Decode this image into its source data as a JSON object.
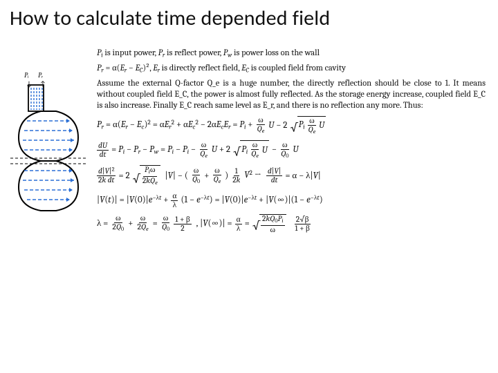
{
  "slide": {
    "title": "How to calculate time depended field"
  },
  "labels": {
    "Pi": "Pᵢ",
    "Pr": "Pᵣ"
  },
  "intro": {
    "line1_a": "P_i is input power, P_r is reflect power, P_w is power loss on the wall",
    "line2_a": "P_r = α(E_r − E_C)², E_r is directly reflect field, E_C is coupled field from cavity",
    "line3": "Assume the external Q-factor Q_e is a huge number, the directly reflection should be close to 1. It means without coupled field E_C, the power is almost fully reflected. As the storage energy increase, coupled field E_C is also increase. Finally E_C reach same level as E_r, and there is no reflection any more. Thus:"
  },
  "equations": {
    "eq1": "P_r = α(E_r − E_c)² = αE_r² + αE_c² − 2αE_cE_r = P_i + (ω/Q_e)U − 2√(P_i (ω/Q_e) U)",
    "eq2": "dU/dt = P_i − P_r − P_w = P_i − P_i − (ω/Q_e)U + 2√(P_i (ω/Q_e) U) − (ω/Q_0)U",
    "eq3": "d|V|²/(2k dt) = 2√(P_iω/(2kQ_e)) |V| − (ω/Q_0 + ω/Q_e)(1/2k)V² → d|V|/dt = α − λ|V|",
    "eq4": "|V(t)| = |V(0)|e^{−λt} + (α/λ)(1 − e^{−λt}) = |V(0)|e^{−λt} + |V(∞)|(1 − e^{−λt})",
    "eq5": "λ = ω/(2Q_0) + ω/(2Q_e) = (ω/Q_0)(1+β)/2 ,  |V(∞)| = α/λ = √(2kQ_0P_i/ω) · 2√β/(1+β)"
  }
}
